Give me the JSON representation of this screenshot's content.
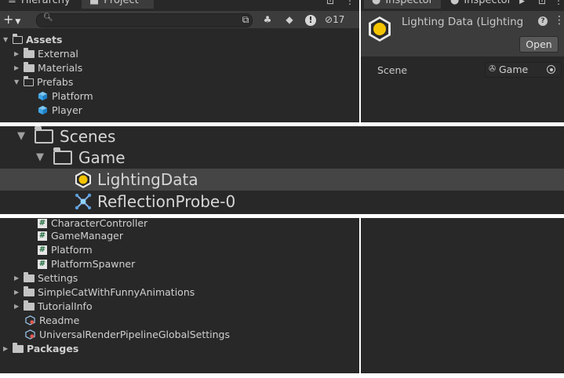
{
  "tabs": {
    "hierarchy": "Hierarchy",
    "project": "Project",
    "inspector_1": "Inspector",
    "inspector_2": "Inspector"
  },
  "project_toolbar": {
    "add_label": "+",
    "search_placeholder": "",
    "hidden_count": "17"
  },
  "project_tree_top": [
    {
      "label": "Assets",
      "icon": "folder-open-icon",
      "arrow": "expanded"
    },
    {
      "label": "External",
      "icon": "folder-icon",
      "arrow": "collapsed"
    },
    {
      "label": "Materials",
      "icon": "folder-icon",
      "arrow": "collapsed"
    },
    {
      "label": "Prefabs",
      "icon": "folder-open-icon",
      "arrow": "expanded"
    },
    {
      "label": "Platform",
      "icon": "prefab-cube-icon"
    },
    {
      "label": "Player",
      "icon": "prefab-cube-icon"
    }
  ],
  "zoom_tree": [
    {
      "label": "Scenes",
      "icon": "folder-open-icon",
      "arrow": "expanded"
    },
    {
      "label": "Game",
      "icon": "folder-open-icon",
      "arrow": "expanded"
    },
    {
      "label": "LightingData",
      "icon": "lighting-data-icon",
      "selected": true
    },
    {
      "label": "ReflectionProbe-0",
      "icon": "reflection-probe-icon"
    }
  ],
  "project_tree_bottom": [
    {
      "label": "CharacterController",
      "icon": "script-icon"
    },
    {
      "label": "GameManager",
      "icon": "script-icon"
    },
    {
      "label": "Platform",
      "icon": "script-icon"
    },
    {
      "label": "PlatformSpawner",
      "icon": "script-icon"
    },
    {
      "label": "Settings",
      "icon": "folder-icon",
      "arrow": "collapsed"
    },
    {
      "label": "SimpleCatWithFunnyAnimations",
      "icon": "folder-icon",
      "arrow": "collapsed"
    },
    {
      "label": "TutorialInfo",
      "icon": "folder-icon",
      "arrow": "collapsed"
    },
    {
      "label": "Readme",
      "icon": "readme-asset-icon"
    },
    {
      "label": "UniversalRenderPipelineGlobalSettings",
      "icon": "render-settings-icon"
    },
    {
      "label": "Packages",
      "icon": "folder-icon",
      "arrow": "collapsed"
    }
  ],
  "inspector": {
    "title": "Lighting Data (Lighting",
    "open_button": "Open",
    "scene_label": "Scene",
    "scene_value": "Game"
  },
  "colors": {
    "panel_bg": "#282828",
    "toolbar_bg": "#3c3c3c",
    "selection_bg": "#454545",
    "lighting_icon_yellow": "#f5c400",
    "prefab_blue": "#3fa6e8"
  }
}
